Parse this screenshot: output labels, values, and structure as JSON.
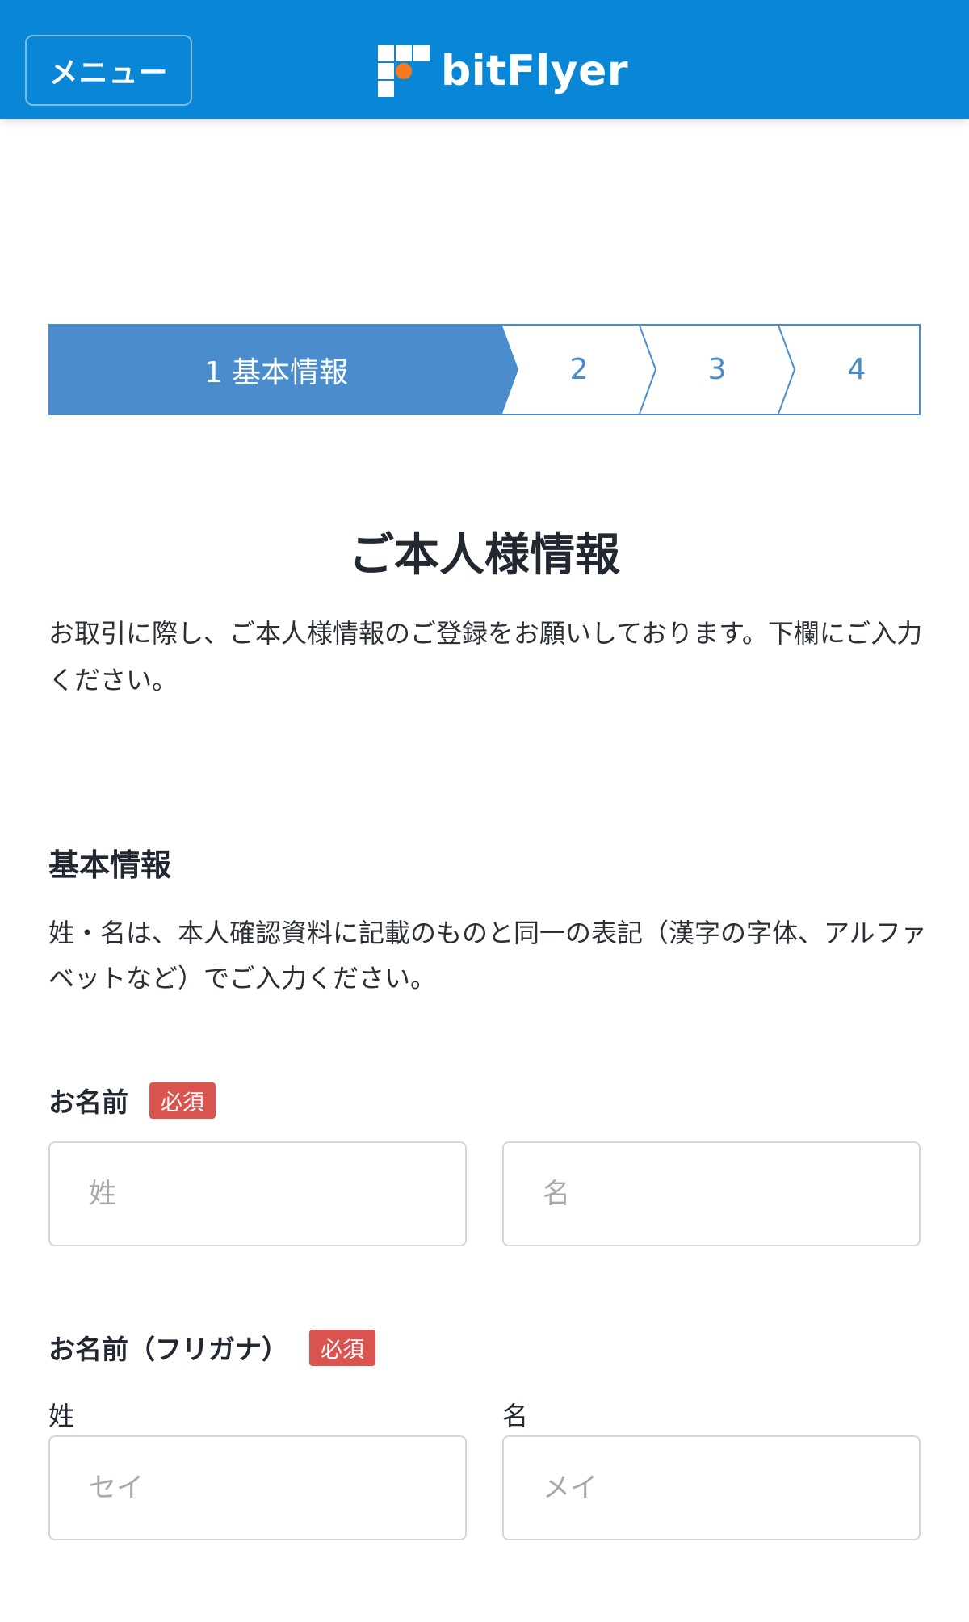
{
  "header": {
    "menu_label": "メニュー",
    "logo_text": "bitFlyer",
    "background": "#0a86d6",
    "logo_accent": "#f47b20"
  },
  "stepper": {
    "steps": [
      {
        "label": "1 基本情報",
        "active": true
      },
      {
        "label": "2",
        "active": false
      },
      {
        "label": "3",
        "active": false
      },
      {
        "label": "4",
        "active": false
      }
    ],
    "active_color": "#4a8ccc"
  },
  "page": {
    "title": "ご本人様情報",
    "intro": "お取引に際し、ご本人様情報のご登録をお願いしております。下欄にご入力ください。"
  },
  "section": {
    "title": "基本情報",
    "note": "姓・名は、本人確認資料に記載のものと同一の表記（漢字の字体、アルファベットなど）でご入力ください。"
  },
  "name_field": {
    "label": "お名前",
    "badge": "必須",
    "last_placeholder": "姓",
    "first_placeholder": "名"
  },
  "kana_field": {
    "label": "お名前（フリガナ）",
    "badge": "必須",
    "last_sub_label": "姓",
    "first_sub_label": "名",
    "last_placeholder": "セイ",
    "first_placeholder": "メイ"
  },
  "colors": {
    "required_badge": "#d9534f"
  }
}
